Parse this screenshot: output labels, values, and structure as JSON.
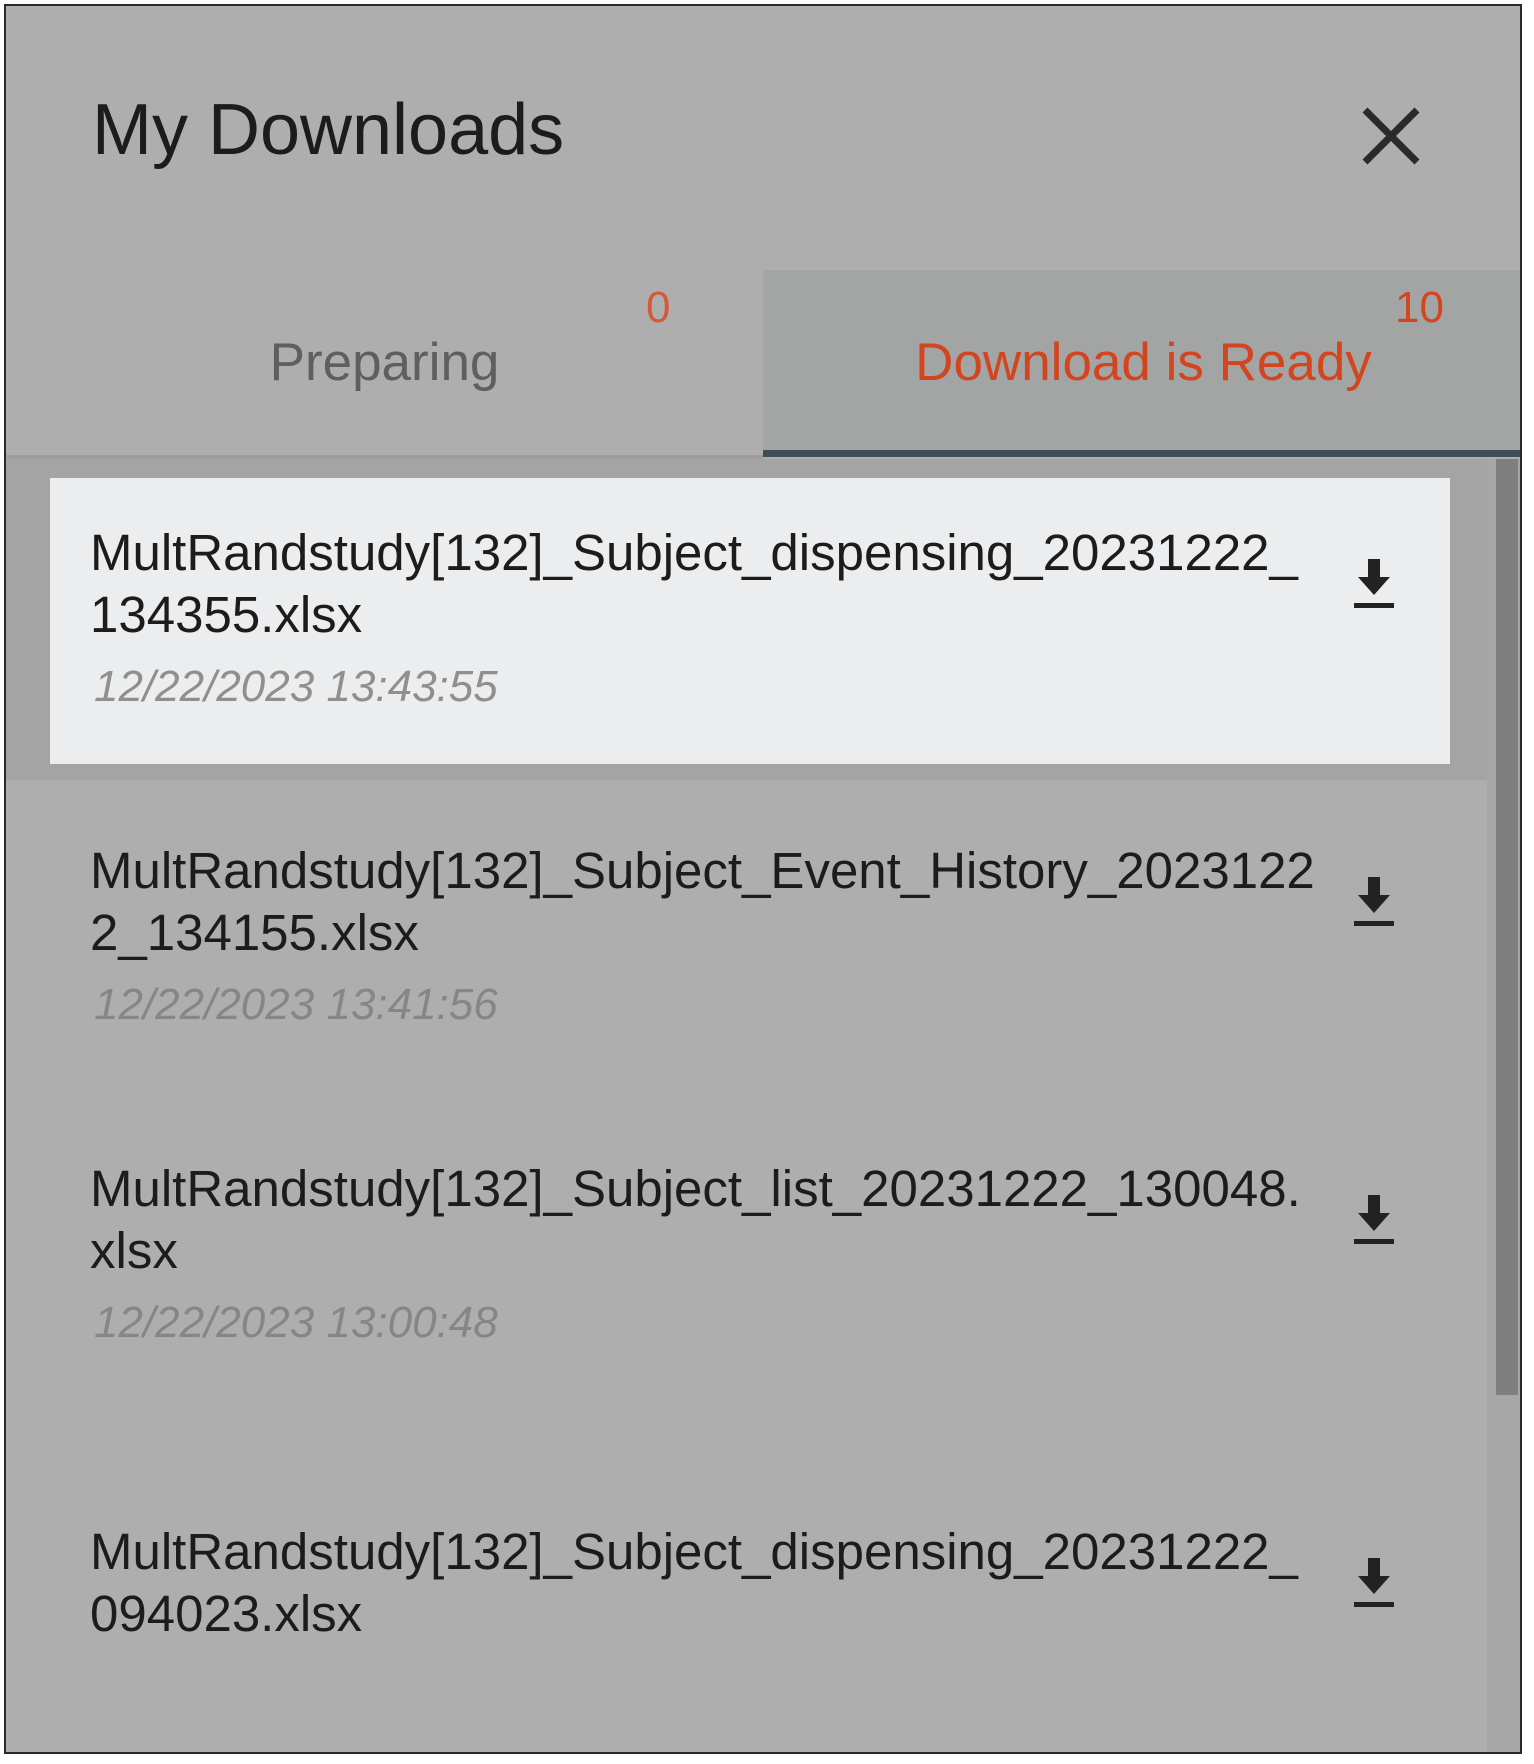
{
  "header": {
    "title": "My Downloads",
    "close_icon": "close-icon"
  },
  "tabs": [
    {
      "label": "Preparing",
      "count": "0",
      "active": false
    },
    {
      "label": "Download is Ready",
      "count": "10",
      "active": true
    }
  ],
  "downloads": [
    {
      "filename": "MultRandstudy[132]_Subject_dispensing_20231222_134355.xlsx",
      "timestamp": "12/22/2023 13:43:55",
      "selected": true
    },
    {
      "filename": "MultRandstudy[132]_Subject_Event_History_20231222_134155.xlsx",
      "timestamp": "12/22/2023 13:41:56",
      "selected": false
    },
    {
      "filename": "MultRandstudy[132]_Subject_list_20231222_130048.xlsx",
      "timestamp": "12/22/2023 13:00:48",
      "selected": false
    },
    {
      "filename": "MultRandstudy[132]_Subject_dispensing_20231222_094023.xlsx",
      "timestamp": "",
      "selected": false
    }
  ],
  "colors": {
    "accent": "#d2451f",
    "panel_bg": "#aeaeae",
    "selected_bg": "#ecedee",
    "tab_indicator": "#3f4f57"
  }
}
